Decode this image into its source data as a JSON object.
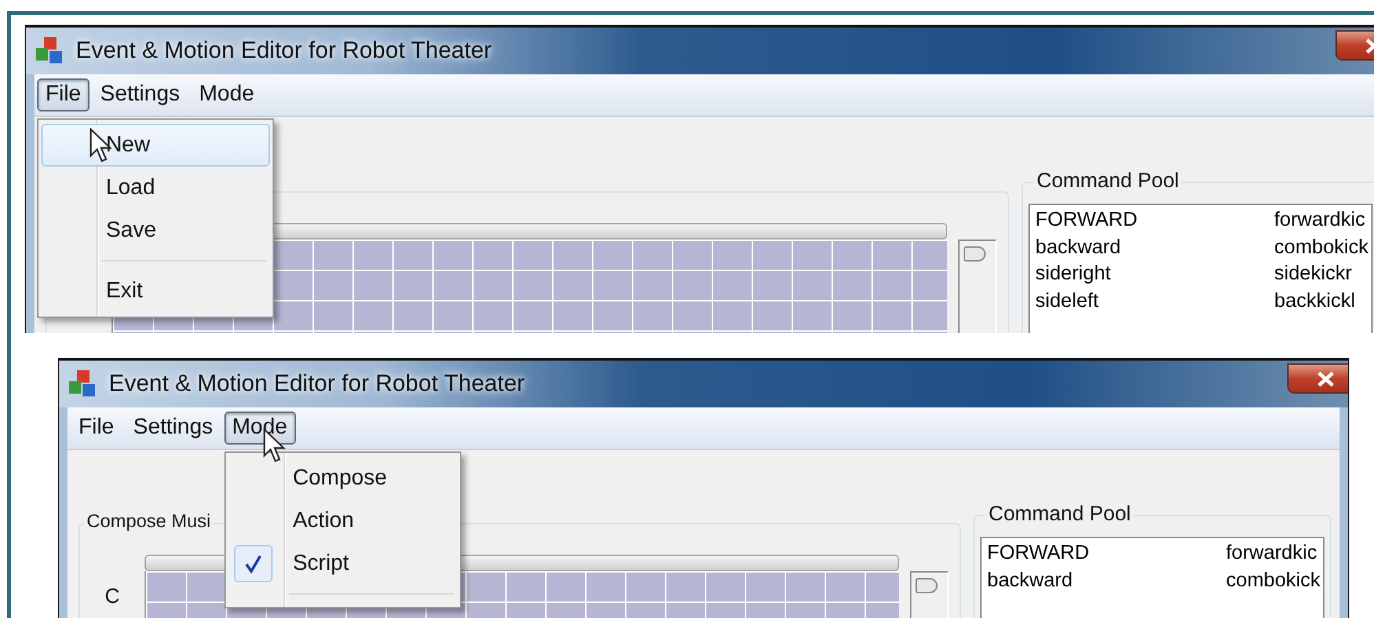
{
  "screenshots": [
    {
      "window": {
        "title": "Event & Motion Editor for Robot Theater"
      },
      "menu_bar": [
        {
          "label": "File",
          "selected": true
        },
        {
          "label": "Settings",
          "selected": false
        },
        {
          "label": "Mode",
          "selected": false
        }
      ],
      "open_menu": [
        {
          "kind": "item",
          "label": "New",
          "highlighted": true,
          "checked": false
        },
        {
          "kind": "item",
          "label": "Load",
          "highlighted": false,
          "checked": false
        },
        {
          "kind": "item",
          "label": "Save",
          "highlighted": false,
          "checked": false
        },
        {
          "kind": "separator"
        },
        {
          "kind": "item",
          "label": "Exit",
          "highlighted": false,
          "checked": false
        }
      ],
      "command_pool": {
        "title": "Command Pool",
        "rows": [
          [
            "FORWARD",
            "forwardkic"
          ],
          [
            "backward",
            "combokick"
          ],
          [
            "sideright",
            "sidekickr"
          ],
          [
            "sideleft",
            "backkickl"
          ]
        ]
      }
    },
    {
      "window": {
        "title": "Event & Motion Editor for Robot Theater"
      },
      "menu_bar": [
        {
          "label": "File",
          "selected": false
        },
        {
          "label": "Settings",
          "selected": false
        },
        {
          "label": "Mode",
          "selected": true
        }
      ],
      "open_menu": [
        {
          "kind": "item",
          "label": "Compose",
          "highlighted": false,
          "checked": false
        },
        {
          "kind": "item",
          "label": "Action",
          "highlighted": false,
          "checked": false
        },
        {
          "kind": "item",
          "label": "Script",
          "highlighted": false,
          "checked": true
        },
        {
          "kind": "separator"
        }
      ],
      "compose_group": {
        "title": "Compose Musi",
        "row_labels": [
          "C"
        ]
      },
      "command_pool": {
        "title": "Command Pool",
        "rows": [
          [
            "FORWARD",
            "forwardkic"
          ],
          [
            "backward",
            "combokick"
          ]
        ]
      }
    }
  ]
}
